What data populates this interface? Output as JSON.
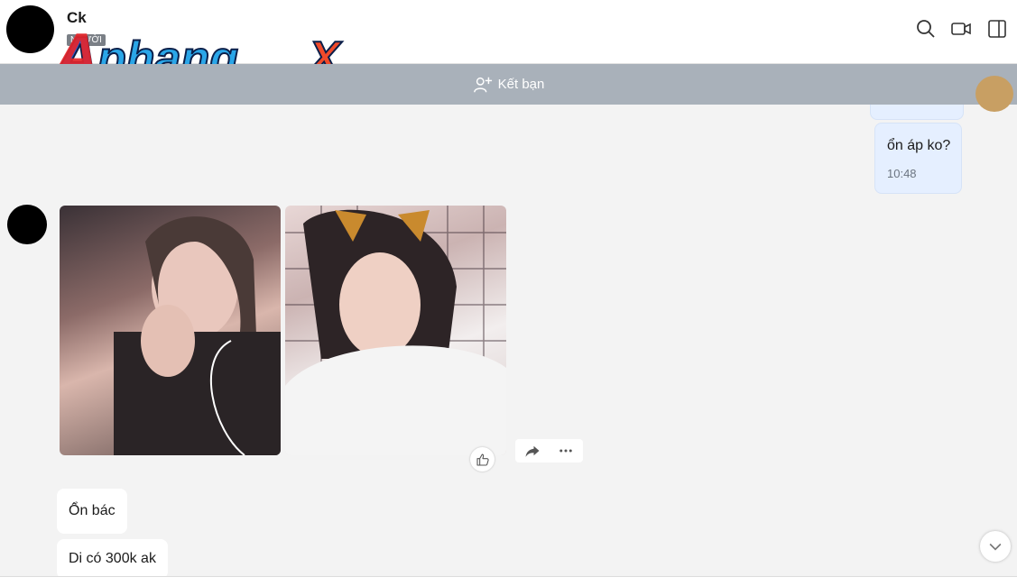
{
  "header": {
    "contact_name": "Ck",
    "tag": "NGƯỜI",
    "logo_text": "Aphangx",
    "icons": [
      "search-icon",
      "video-call-icon",
      "sidebar-toggle-icon"
    ]
  },
  "friend_bar": {
    "label": "Kết bạn",
    "icon": "add-friend-icon"
  },
  "messages": {
    "right": {
      "text": "ổn áp ko?",
      "time": "10:48"
    },
    "left": [
      {
        "text": "Ổn bác"
      },
      {
        "text": "Di có 300k ak"
      }
    ]
  },
  "colors": {
    "friend_bar": "#a9b1ba",
    "own_bubble": "#e5efff",
    "background": "#f3f3f3"
  }
}
